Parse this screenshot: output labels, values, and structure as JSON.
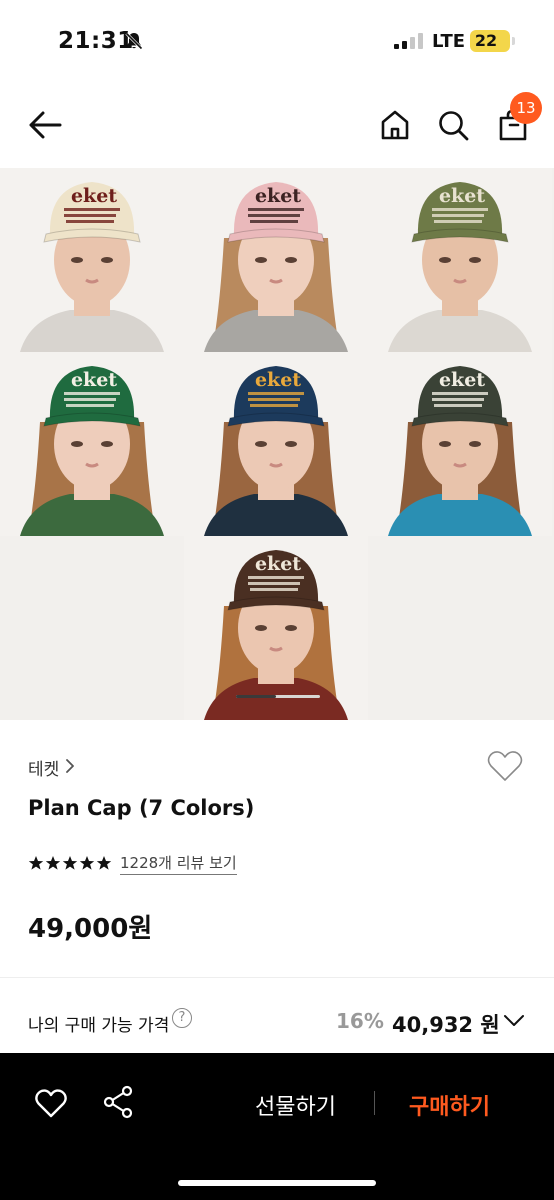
{
  "status_bar": {
    "time": "21:31",
    "network": "LTE",
    "battery": "22",
    "battery_color": "#f3d64a",
    "bell_icon": "bell-slash-icon"
  },
  "nav": {
    "back_icon": "arrow-left-icon",
    "home_icon": "home-icon",
    "search_icon": "search-icon",
    "bag_icon": "shopping-bag-icon",
    "cart_count": "13"
  },
  "gallery": {
    "image_count_shown": 7,
    "hat_colors": [
      "#eee3c9",
      "#eab9bb",
      "#6e7a47",
      "#1f6b3f",
      "#1c3a5c",
      "#3a4236",
      "#4a2f22"
    ],
    "hat_text_colors": [
      "#6e1e1a",
      "#3c2222",
      "#e8e2d0",
      "#f2efe4",
      "#e9a93c",
      "#f0ede2",
      "#efe7d8"
    ],
    "logo_text": "eket",
    "active_page": 1
  },
  "product": {
    "brand": "테켓",
    "title": "Plan Cap (7 Colors)",
    "rating": 5,
    "reviews": "1228개 리뷰 보기",
    "price": "49,000원",
    "wishlist_icon": "heart-outline-icon"
  },
  "my_price": {
    "label": "나의 구매 가능 가격",
    "help": "?",
    "discount": "16%",
    "amount": "40,932 원"
  },
  "bottom_bar": {
    "heart_icon": "heart-outline-icon",
    "share_icon": "share-icon",
    "gift_label": "선물하기",
    "buy_label": "구매하기",
    "accent": "#ff5a1f"
  }
}
